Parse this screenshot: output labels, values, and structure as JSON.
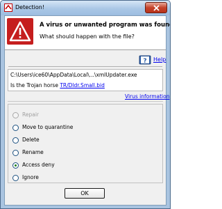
{
  "window": {
    "title": "Detection!"
  },
  "header": {
    "title": "A virus or unwanted program was found!",
    "subtitle": "What should happen with the file?"
  },
  "help": {
    "label": "Help"
  },
  "detection": {
    "file_path": "C:\\Users\\ice60\\AppData\\Local\\...\\xmlUpdater.exe",
    "trojan_prefix": "Is the Trojan horse ",
    "trojan_name": "TR/Dldr.Small.bid",
    "virus_info_label": "Virus information"
  },
  "options": [
    {
      "label": "Repair",
      "checked": false,
      "disabled": true
    },
    {
      "label": "Move to quarantine",
      "checked": false,
      "disabled": false
    },
    {
      "label": "Delete",
      "checked": false,
      "disabled": false
    },
    {
      "label": "Rename",
      "checked": false,
      "disabled": false
    },
    {
      "label": "Access deny",
      "checked": true,
      "disabled": false
    },
    {
      "label": "Ignore",
      "checked": false,
      "disabled": false
    }
  ],
  "ok_label": "OK",
  "colors": {
    "warning_red": "#c51e1e",
    "link": "#0000ee",
    "selected_radio": "#1a7f1a"
  },
  "icons": {
    "app": "avira-umbrella-icon",
    "warning": "warning-triangle-icon",
    "help": "help-book-icon",
    "close": "close-icon"
  }
}
